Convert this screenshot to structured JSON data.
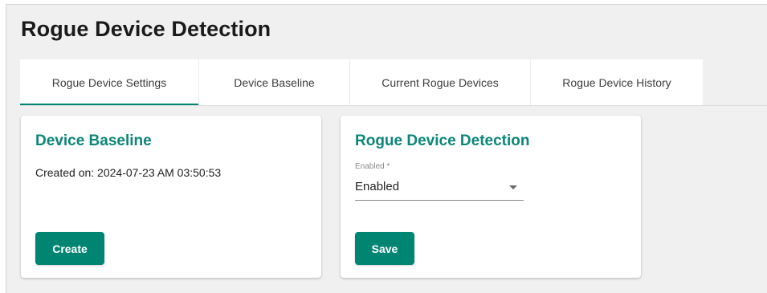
{
  "page": {
    "title": "Rogue Device Detection"
  },
  "tabs": [
    {
      "label": "Rogue Device Settings",
      "active": true
    },
    {
      "label": "Device Baseline",
      "active": false
    },
    {
      "label": "Current Rogue Devices",
      "active": false
    },
    {
      "label": "Rogue Device History",
      "active": false
    }
  ],
  "baseline_card": {
    "title": "Device Baseline",
    "created_text": "Created on: 2024-07-23 AM 03:50:53",
    "button_label": "Create"
  },
  "detection_card": {
    "title": "Rogue Device Detection",
    "field_label": "Enabled *",
    "field_value": "Enabled",
    "button_label": "Save"
  },
  "colors": {
    "accent": "#008573",
    "card_title": "#0c8678",
    "page_background": "#f0f0f0"
  },
  "icons": {
    "dropdown": "caret-down-icon"
  }
}
